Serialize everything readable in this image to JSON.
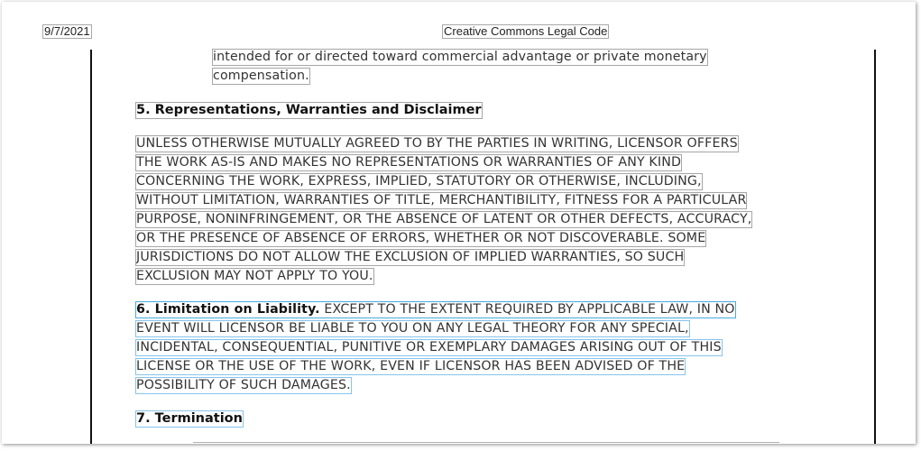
{
  "header": {
    "date": "9/7/2021",
    "title": "Creative Commons Legal Code"
  },
  "continuation": [
    "intended for or directed toward commercial advantage or private monetary",
    "compensation."
  ],
  "section5": {
    "heading": "5. Representations, Warranties and Disclaimer",
    "lines": [
      "UNLESS OTHERWISE MUTUALLY AGREED TO BY THE PARTIES IN WRITING, LICENSOR OFFERS",
      "THE WORK AS-IS AND MAKES NO REPRESENTATIONS OR WARRANTIES OF ANY KIND",
      "CONCERNING THE WORK, EXPRESS, IMPLIED, STATUTORY OR OTHERWISE, INCLUDING,",
      "WITHOUT LIMITATION, WARRANTIES OF TITLE, MERCHANTIBILITY, FITNESS FOR A PARTICULAR",
      "PURPOSE, NONINFRINGEMENT, OR THE ABSENCE OF LATENT OR OTHER DEFECTS, ACCURACY,",
      "OR THE PRESENCE OF ABSENCE OF ERRORS, WHETHER OR NOT DISCOVERABLE. SOME",
      "JURISDICTIONS DO NOT ALLOW THE EXCLUSION OF IMPLIED WARRANTIES, SO SUCH",
      "EXCLUSION MAY NOT APPLY TO YOU."
    ]
  },
  "section6": {
    "heading": "6. Limitation on Liability.",
    "first_line_rest": " EXCEPT TO THE EXTENT REQUIRED BY APPLICABLE LAW, IN NO",
    "lines": [
      "EVENT WILL LICENSOR BE LIABLE TO YOU ON ANY LEGAL THEORY FOR ANY SPECIAL,",
      "INCIDENTAL, CONSEQUENTIAL, PUNITIVE OR EXEMPLARY DAMAGES ARISING OUT OF THIS",
      "LICENSE OR THE USE OF THE WORK, EVEN IF LICENSOR HAS BEEN ADVISED OF THE",
      "POSSIBILITY OF SUCH DAMAGES."
    ]
  },
  "section7": {
    "heading": "7. Termination"
  }
}
